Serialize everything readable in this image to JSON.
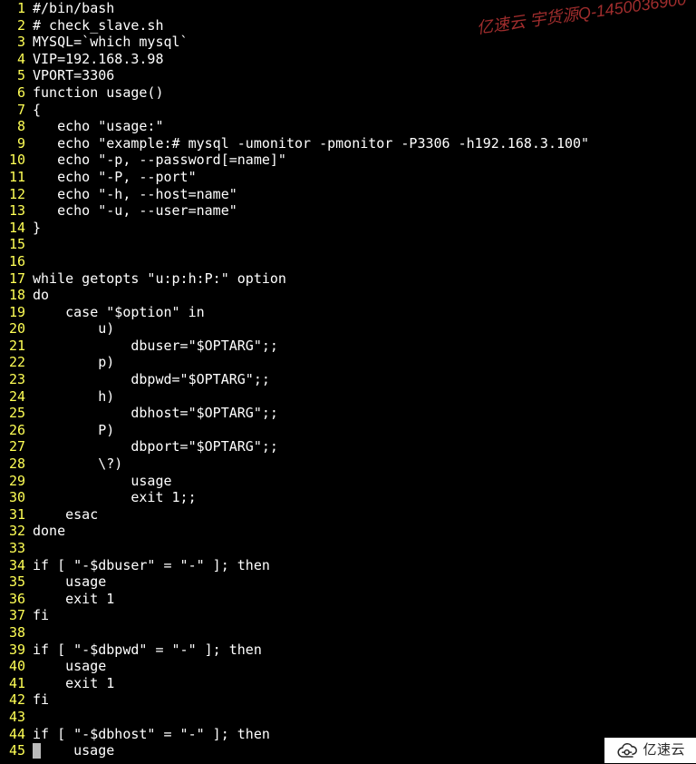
{
  "watermark": "亿速云 宇货源Q-1450036900",
  "logo_text": "亿速云",
  "code_lines": [
    "#/bin/bash",
    "# check_slave.sh",
    "MYSQL=`which mysql`",
    "VIP=192.168.3.98",
    "VPORT=3306",
    "function usage()",
    "{",
    "   echo \"usage:\"",
    "   echo \"example:# mysql -umonitor -pmonitor -P3306 -h192.168.3.100\"",
    "   echo \"-p, --password[=name]\"",
    "   echo \"-P, --port\"",
    "   echo \"-h, --host=name\"",
    "   echo \"-u, --user=name\"",
    "}",
    "",
    "",
    "while getopts \"u:p:h:P:\" option",
    "do",
    "    case \"$option\" in",
    "        u)",
    "            dbuser=\"$OPTARG\";;",
    "        p)",
    "            dbpwd=\"$OPTARG\";;",
    "        h)",
    "            dbhost=\"$OPTARG\";;",
    "        P)",
    "            dbport=\"$OPTARG\";;",
    "        \\?)",
    "            usage",
    "            exit 1;;",
    "    esac",
    "done",
    "",
    "if [ \"-$dbuser\" = \"-\" ]; then",
    "    usage",
    "    exit 1",
    "fi",
    "",
    "if [ \"-$dbpwd\" = \"-\" ]; then",
    "    usage",
    "    exit 1",
    "fi",
    "",
    "if [ \"-$dbhost\" = \"-\" ]; then",
    "    usage"
  ],
  "cursor_line_index": 44
}
